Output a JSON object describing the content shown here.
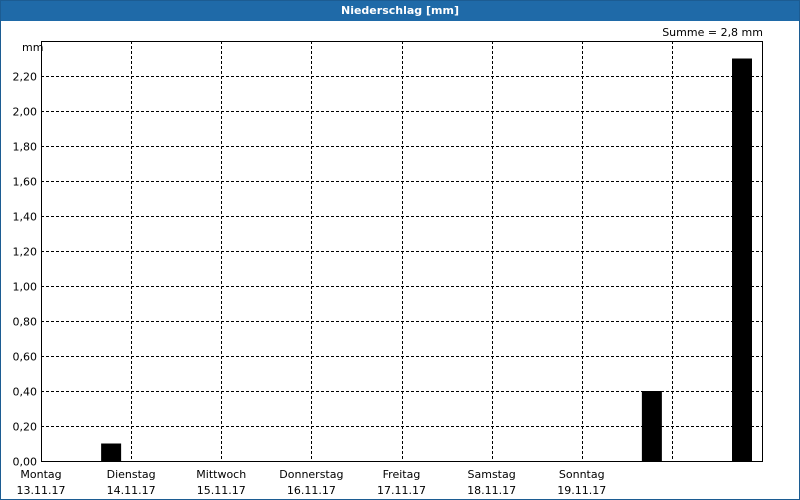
{
  "header": {
    "title": "Niederschlag [mm]"
  },
  "summary": "Summe = 2,8 mm",
  "chart_data": {
    "type": "bar",
    "title": "Niederschlag [mm]",
    "ylabel": "mm",
    "ylim": [
      0,
      2.4
    ],
    "yticks": [
      "0,00",
      "0,20",
      "0,40",
      "0,60",
      "0,80",
      "1,00",
      "1,20",
      "1,40",
      "1,60",
      "1,80",
      "2,00",
      "2,20"
    ],
    "grid": true,
    "categories": [
      {
        "day": "Montag",
        "date": "13.11.17"
      },
      {
        "day": "Dienstag",
        "date": "14.11.17"
      },
      {
        "day": "Mittwoch",
        "date": "15.11.17"
      },
      {
        "day": "Donnerstag",
        "date": "16.11.17"
      },
      {
        "day": "Freitag",
        "date": "17.11.17"
      },
      {
        "day": "Samstag",
        "date": "18.11.17"
      },
      {
        "day": "Sonntag",
        "date": "19.11.17"
      },
      {
        "day": "",
        "date": ""
      }
    ],
    "values": [
      0.1,
      0,
      0,
      0,
      0,
      0,
      0.4,
      2.3
    ],
    "bar_color": "#000000"
  }
}
